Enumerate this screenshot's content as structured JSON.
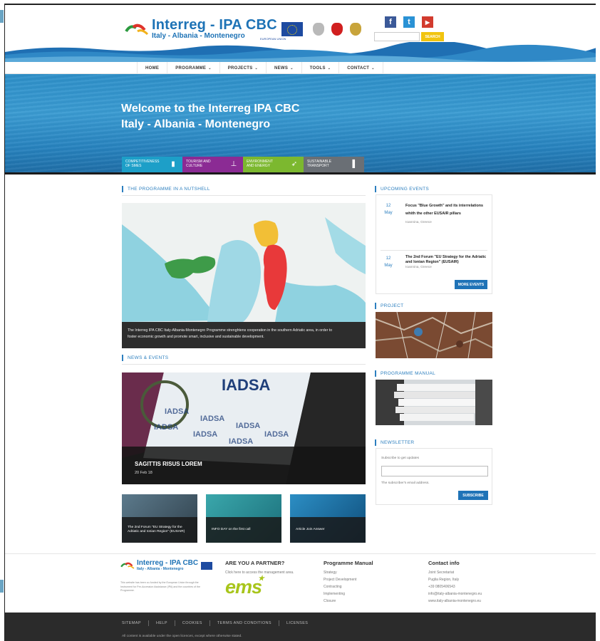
{
  "header": {
    "logo_main": "Interreg - IPA CBC",
    "logo_sub": "Italy - Albania - Montenegro",
    "eu_caption": "EUROPEAN UNION",
    "social": [
      {
        "icon": "facebook-icon",
        "glyph": "f",
        "color": "#3b5998"
      },
      {
        "icon": "twitter-icon",
        "glyph": "t",
        "color": "#2a92d5"
      },
      {
        "icon": "youtube-icon",
        "glyph": "▶",
        "color": "#d23b2e"
      }
    ],
    "search_placeholder": "",
    "search_label": "SEARCH"
  },
  "nav": {
    "items": [
      {
        "label": "HOME",
        "caret": ""
      },
      {
        "label": "PROGRAMME",
        "caret": "⌄"
      },
      {
        "label": "PROJECTS",
        "caret": "⌄"
      },
      {
        "label": "NEWS",
        "caret": "⌄"
      },
      {
        "label": "TOOLS",
        "caret": "⌄"
      },
      {
        "label": "CONTACT",
        "caret": "⌄"
      }
    ]
  },
  "hero": {
    "title_line1": "Welcome to the Interreg IPA CBC",
    "title_line2": "Italy - Albania - Montenegro",
    "axes": [
      {
        "label_l1": "COMPETITIVENESS",
        "label_l2": "OF SMES",
        "color": "#1d9fc8",
        "icon": "buildings-icon"
      },
      {
        "label_l1": "TOURISM AND",
        "label_l2": "CULTURE",
        "color": "#8b2b94",
        "icon": "signpost-icon"
      },
      {
        "label_l1": "ENVIRONMENT",
        "label_l2": "AND ENERGY",
        "color": "#7cb82f",
        "icon": "leaf-icon"
      },
      {
        "label_l1": "SUSTAINABLE",
        "label_l2": "TRANSPORT",
        "color": "#6a6f75",
        "icon": "road-icon"
      }
    ]
  },
  "nutshell": {
    "heading": "THE PROGRAMME IN A NUTSHELL",
    "caption_l1": "The Interreg IPA CBC Italy-Albania-Montenegro Programme strenghtens cooperation in the southern Adriatic area, in order to",
    "caption_l2": "foster economic growth and promote smart, inclusive and sustainable development."
  },
  "news": {
    "heading": "NEWS & EVENTS",
    "big_title": "SAGITTIS RISUS LOREM",
    "big_date": "20 Feb 18",
    "big_image_word": "IADSA",
    "thumbs": [
      {
        "caption": "The 2nd Forum \"EU Strategy for the Adriatic and Ionian Region\" (EUSAIR)"
      },
      {
        "caption": "INFO DAY on the first call"
      },
      {
        "caption": "Article Join Answer"
      }
    ]
  },
  "events": {
    "heading": "UPCOMING EVENTS",
    "items": [
      {
        "day": "12",
        "month": "May",
        "title": "Focus \"Blue Growth\" and its interrelations whith the other EUSAIR pillars",
        "place": "Ioannina, Greece"
      },
      {
        "day": "12",
        "month": "May",
        "title": "The 2nd Forum \"EU Strategy for the Adriatic and Ionian Region\" (EUSAIR)",
        "place": "Ioannina, Greece"
      }
    ],
    "more_label": "MORE EVENTS"
  },
  "project": {
    "heading": "PROJECT"
  },
  "manual": {
    "heading": "PROGRAMME MANUAL"
  },
  "newsletter": {
    "heading": "NEWSLETTER",
    "label": "Subscribe to get updates",
    "input_value": "",
    "hint": "The subscriber's email address.",
    "button": "SUBSCRIBE"
  },
  "footer": {
    "funded_text": "This website has been co-funded by the European Union through the Instrument for Pre-Accession Assistance (IPA) and the countries of the Programme.",
    "partner_title": "ARE YOU A PARTNER?",
    "partner_text": "Click here to access the management area.",
    "ems_logo": "ems",
    "manual_title": "Programme Manual",
    "manual_links": [
      "Strategy",
      "Project Development",
      "Contracting",
      "Implementing",
      "Closure"
    ],
    "contact_title": "Contact info",
    "contact_lines": [
      "Joint Secretariat",
      "Puglia Region, Italy",
      "+39 0805406543",
      "info@italy-albania-montenegro.eu",
      "www.italy-albania-montenegro.eu"
    ]
  },
  "bottom": {
    "links": [
      "SITEMAP",
      "HELP",
      "COOKIES",
      "TERMS AND CONDITIONS",
      "LICENSES"
    ],
    "note": "All content is available under the open licences, except where otherwise stated."
  }
}
